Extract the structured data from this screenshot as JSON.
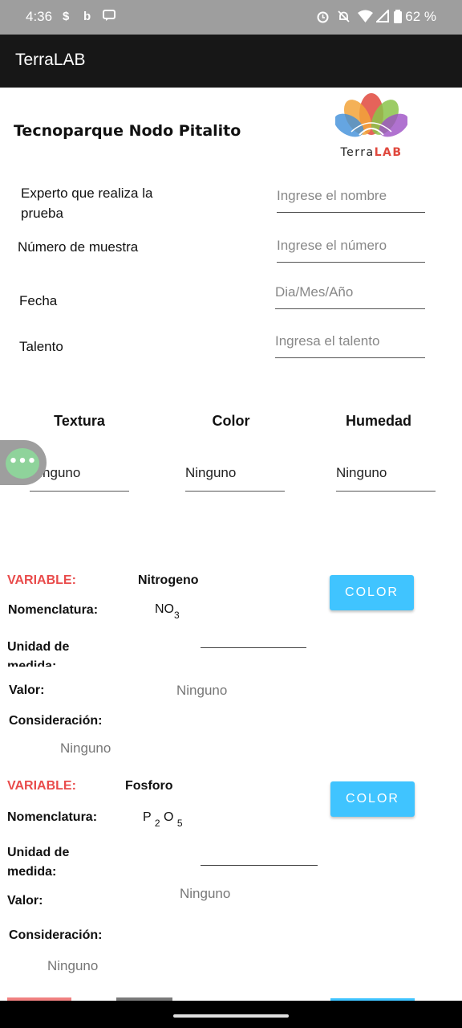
{
  "status": {
    "time": "4:36",
    "battery": "62 %"
  },
  "app": {
    "title": "TerraLAB"
  },
  "header": {
    "title": "Tecnoparque Nodo Pitalito",
    "logo_text_terra": "Terra",
    "logo_text_lab": "LAB"
  },
  "form": {
    "expert_label": "Experto que realiza la prueba",
    "expert_placeholder": "Ingrese el nombre",
    "sample_label": "Número de muestra",
    "sample_placeholder": "Ingrese el número",
    "date_label": "Fecha",
    "date_placeholder": "Dia/Mes/Año",
    "talent_label": "Talento",
    "talent_placeholder": "Ingresa el talento"
  },
  "properties": {
    "headers": [
      "Textura",
      "Color",
      "Humedad"
    ],
    "values": [
      "Ninguno",
      "Ninguno",
      "Ninguno"
    ]
  },
  "variables": [
    {
      "var_label": "VARIABLE:",
      "name": "Nitrogeno",
      "button": "COLOR",
      "nomenclature_label": "Nomenclatura:",
      "formula_main": "NO",
      "formula_sub": "3",
      "unit_label": "Unidad de medida:",
      "value_label": "Valor:",
      "value": "Ninguno",
      "consideration_label": "Consideración:",
      "consideration": "Ninguno"
    },
    {
      "var_label": "VARIABLE:",
      "name": "Fosforo",
      "button": "COLOR",
      "nomenclature_label": "Nomenclatura:",
      "formula_p": "P",
      "formula_sub1": "2",
      "formula_o": "O",
      "formula_sub2": "5",
      "unit_label": "Unidad de medida:",
      "value_label": "Valor:",
      "value": "Ninguno",
      "consideration_label": "Consideración:",
      "consideration": "Ninguno"
    }
  ],
  "colors": {
    "accent_button": "#40c4ff",
    "variable_label": "#e94b4b",
    "appbar": "#171717",
    "statusbar": "#9e9e9e",
    "bubble": "#8fd39b"
  },
  "icons": [
    "signal-s-icon",
    "bing-icon",
    "message-icon",
    "alarm-icon",
    "mute-icon",
    "wifi-icon",
    "cell-signal-icon",
    "battery-icon",
    "chat-bubble-icon"
  ]
}
